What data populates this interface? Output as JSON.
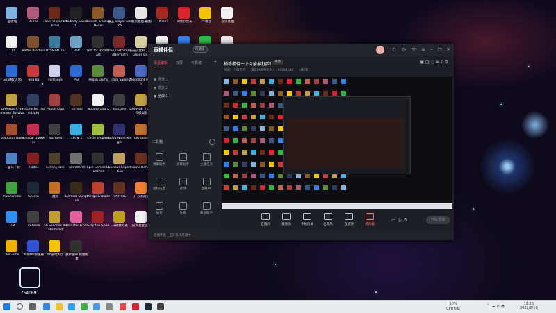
{
  "desktop": {
    "colors": {
      "space": "#0e0a1c",
      "nebula": "#c84a1e",
      "star": "#9cc8ff"
    },
    "icons": [
      {
        "label": "回收站",
        "color": "#7fb3e0"
      },
      {
        "label": "Annie",
        "color": "#b05a7a"
      },
      {
        "label": "Devil Slayer Raksasi",
        "color": "#6a2a1a"
      },
      {
        "label": "Nobody Saves t...",
        "color": "#222"
      },
      {
        "label": "Swords & Souls Never",
        "color": "#8a5a2a"
      },
      {
        "label": "霸王 Slayer Smite",
        "color": "#3a5a8a"
      },
      {
        "label": "投资基金-截图",
        "color": "#e6e6e6"
      },
      {
        "label": "DOTA2",
        "color": "#a0281e"
      },
      {
        "label": "网易云音乐",
        "color": "#d9242f"
      },
      {
        "label": "YY语音",
        "color": "#f2c500"
      },
      {
        "label": "投资基金",
        "color": "#f0f0f0"
      },
      {
        "label": "111",
        "color": "#f0f0f0"
      },
      {
        "label": "Battle Brothers",
        "color": "#7a5030"
      },
      {
        "label": "DYSMANTLE",
        "color": "#3a7a9a"
      },
      {
        "label": "Raft",
        "color": "#6fa0c0"
      },
      {
        "label": "Not for Broadcast",
        "color": "#303030"
      },
      {
        "label": "The Last Stand Aftermath",
        "color": "#7a2a2a"
      },
      {
        "label": "猫猫汉化补丁2 Curious Ex...",
        "color": "#d8d0a0"
      },
      {
        "label": "软件",
        "color": "#f0f0f0"
      },
      {
        "label": "百度网盘",
        "color": "#2f7ff0"
      },
      {
        "label": "微信",
        "color": "#2fba3f"
      },
      {
        "label": "投资基金",
        "color": "#e8e8e8"
      },
      {
        "label": "GearN70.46",
        "color": "#2b6bd1"
      },
      {
        "label": "-Big Ba",
        "color": "#c43b3b"
      },
      {
        "label": "Fall Guys",
        "color": "#d0d0f0"
      },
      {
        "label": "PS4",
        "color": "#2b6bd1"
      },
      {
        "label": "Peglin Demo",
        "color": "#5a8a3a"
      },
      {
        "label": "Trash Sailors",
        "color": "#c06050"
      },
      {
        "label": "Moonlight Peaks",
        "color": "#4a6ac0"
      },
      {
        "label": "CHANGE A Homeless Survival",
        "color": "#c0a040"
      },
      {
        "label": "FTL Faster Than Light",
        "color": "#304060"
      },
      {
        "label": "Punch Club",
        "color": "#a04040"
      },
      {
        "label": "Turmoil",
        "color": "#503020"
      },
      {
        "label": "Boomerang X",
        "color": "#f0f0f0"
      },
      {
        "label": "Wartales",
        "color": "#404040"
      },
      {
        "label": "CHANGE 无家可归模拟器",
        "color": "#c0a040"
      },
      {
        "label": "Gladiator Guild",
        "color": "#a05030"
      },
      {
        "label": "Radical Dungeon",
        "color": "#c03050"
      },
      {
        "label": "Wartales",
        "color": "#404040"
      },
      {
        "label": "360安全",
        "color": "#3ab0e0"
      },
      {
        "label": "Circle Empires",
        "color": "#a0c040"
      },
      {
        "label": "Good Night Knight",
        "color": "#303070"
      },
      {
        "label": "ultropolis",
        "color": "#c07030"
      },
      {
        "label": "千里马下载",
        "color": "#5080c0"
      },
      {
        "label": "Hades",
        "color": "#802020"
      },
      {
        "label": "Creepy Tale",
        "color": "#504030"
      },
      {
        "label": "SkinWorld",
        "color": "#707070"
      },
      {
        "label": "Epic Games Launcher",
        "color": "#303030"
      },
      {
        "label": "Curious Expedition",
        "color": "#c0a060"
      },
      {
        "label": "Home Behind",
        "color": "#6a3020"
      },
      {
        "label": "RunZombie",
        "color": "#40a040"
      },
      {
        "label": "Steam",
        "color": "#1b2838"
      },
      {
        "label": "魔兽",
        "color": "#c07020"
      },
      {
        "label": "Darkest Dungeon",
        "color": "#3a2a1a"
      },
      {
        "label": "Merge & Blade",
        "color": "#c04030"
      },
      {
        "label": "SKYHILL",
        "color": "#603020"
      },
      {
        "label": "开心消消乐",
        "color": "#f08030"
      },
      {
        "label": "TIM",
        "color": "#3090f0"
      },
      {
        "label": "Resolve",
        "color": "#404040"
      },
      {
        "label": "60 Seconds Reatomized",
        "color": "#c0a030"
      },
      {
        "label": "Monster Prom",
        "color": "#e060a0"
      },
      {
        "label": "Slay the Spire",
        "color": "#a02020"
      },
      {
        "label": "开箱模拟器",
        "color": "#c0a020"
      },
      {
        "label": "投资基金区版",
        "color": "#f0f0f0"
      },
      {
        "label": "WeGame",
        "color": "#f0b000"
      },
      {
        "label": "网易UU加速器",
        "color": "#3050d0"
      },
      {
        "label": "YY游戏大厅",
        "color": "#f2c500"
      },
      {
        "label": "战争使命 原始版本",
        "color": "#303030"
      }
    ],
    "watermark_text": "7640691"
  },
  "window": {
    "app_name": "直播伴侣",
    "app_badge": "内测版",
    "scene_tabs": [
      "场景编辑",
      "双屏",
      "可靠装"
    ],
    "scene_add": "+",
    "scene_rows": [
      "场景 1",
      "场景 2",
      "全屏 1"
    ],
    "tools_title": "工具箱",
    "tools": [
      "弹幕助手",
      "房管助手",
      "主播任务",
      "视频连麦",
      "录屏",
      "直播PK",
      "抽奖",
      "礼物",
      "数据助手"
    ],
    "live_title": "稍等稍待一下可能被打脸!",
    "edit_label": "修改",
    "category_items": [
      "频道：七日世界",
      "请选择画布比例：1920x1080",
      "分辨率"
    ],
    "bottom_buttons": [
      "直播间",
      "摄像头",
      "手机投屏",
      "麦克风",
      "直播弹",
      "扬声器"
    ],
    "start_live": "开始直播",
    "status_text": "直播伴侣 · 正在等待开播中..."
  },
  "taskbar": {
    "search_icon": "search-icon",
    "cpu_label": "10%",
    "cpu_sub": "CPU负载",
    "time": "19:26",
    "date": "2022/2/10",
    "colors": {
      "bar": "#e9ecef"
    }
  }
}
